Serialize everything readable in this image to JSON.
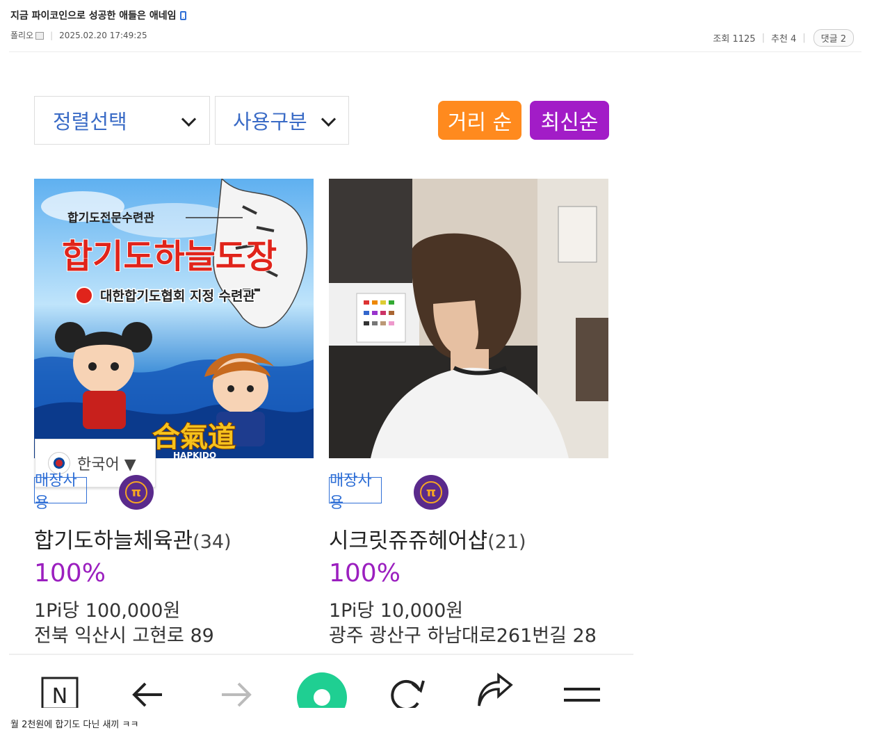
{
  "post": {
    "title": "지금 파이코인으로 성공한 애들은 애네임",
    "author": "폴리오",
    "datetime": "2025.02.20 17:49:25",
    "views": "조회 1125",
    "recommend": "추천 4",
    "replies": "댓글 2",
    "caption": "월 2천원에 합기도 다닌 새끼 ㅋㅋ"
  },
  "screenshot": {
    "sort_dropdown": "정렬선택",
    "usage_dropdown": "사용구분",
    "distance_button": "거리 순",
    "newest_button": "최신순",
    "colors": {
      "distance": "#ff8a1e",
      "newest": "#a21cc7",
      "accent_text": "#3a6bc6",
      "percent": "#9b1fbf"
    },
    "language_selector": "한국어 ▼",
    "stores": [
      {
        "image_header": "합기도전문수련관",
        "image_title": "합기도하늘도장",
        "image_subtitle": "대한합기도협회 지정 수련관",
        "image_hanja": "合氣道",
        "image_bottom": "HAPKIDO",
        "badge": "매장사용",
        "name": "합기도하늘체육관",
        "review_count": "(34)",
        "percent": "100%",
        "rate": "1Pi당 100,000원",
        "address": "전북 익산시 고현로 89"
      },
      {
        "badge": "매장사용",
        "name": "시크릿쥬쥬헤어샵",
        "review_count": "(21)",
        "percent": "100%",
        "rate": "1Pi당 10,000원",
        "address": "광주 광산구 하남대로261번길 28"
      }
    ],
    "nav_icons": [
      "naver-n-icon",
      "back-arrow-icon",
      "forward-arrow-icon",
      "home-circle-icon",
      "refresh-icon",
      "share-icon",
      "menu-icon"
    ]
  }
}
